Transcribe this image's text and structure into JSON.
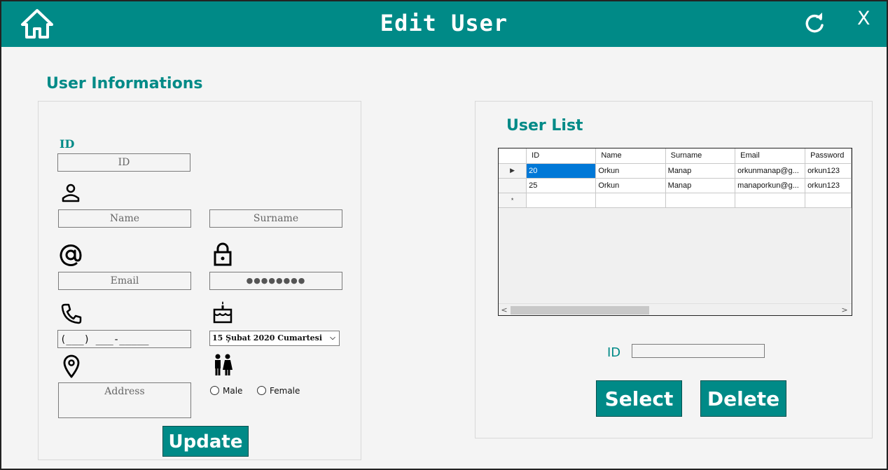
{
  "window": {
    "title": "Edit User",
    "close_label": "X",
    "accent_color": "#008a87"
  },
  "icons": {
    "home": "home-icon",
    "refresh": "refresh-icon",
    "person": "person-icon",
    "email": "at-icon",
    "lock": "lock-icon",
    "phone": "phone-icon",
    "birthday": "cake-icon",
    "location": "location-pin-icon",
    "gender": "gender-icon"
  },
  "user_info": {
    "section_title": "User Informations",
    "id_label": "ID",
    "id_placeholder": "ID",
    "name_placeholder": "Name",
    "surname_placeholder": "Surname",
    "email_placeholder": "Email",
    "password_mask": "●●●●●●●●",
    "phone_mask": "(___) ___-_____",
    "birth_date": "15    Şubat    2020 Cumartesi",
    "address_placeholder": "Address",
    "gender_male": "Male",
    "gender_female": "Female",
    "update_button": "Update"
  },
  "user_list": {
    "section_title": "User List",
    "columns": [
      "ID",
      "Name",
      "Surname",
      "Email",
      "Password"
    ],
    "rows": [
      [
        "20",
        "Orkun",
        "Manap",
        "orkunmanap@g...",
        "orkun123"
      ],
      [
        "25",
        "Orkun",
        "Manap",
        "manaporkun@g...",
        "orkun123"
      ]
    ],
    "current_row_marker": "▶",
    "new_row_marker": "*",
    "scroll_left": "<",
    "scroll_right": ">",
    "id_label": "ID",
    "select_button": "Select",
    "delete_button": "Delete"
  }
}
